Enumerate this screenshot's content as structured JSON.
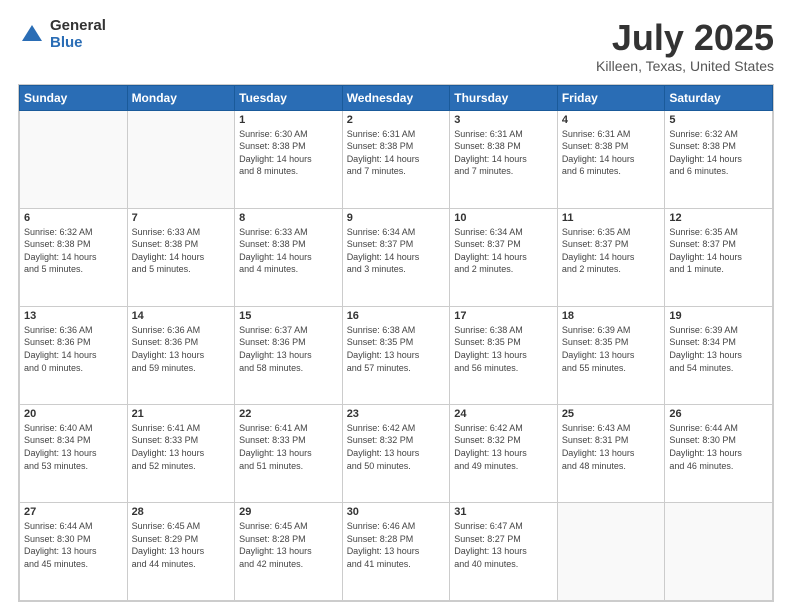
{
  "header": {
    "logo_general": "General",
    "logo_blue": "Blue",
    "month_title": "July 2025",
    "location": "Killeen, Texas, United States"
  },
  "weekdays": [
    "Sunday",
    "Monday",
    "Tuesday",
    "Wednesday",
    "Thursday",
    "Friday",
    "Saturday"
  ],
  "weeks": [
    [
      {
        "day": "",
        "info": ""
      },
      {
        "day": "",
        "info": ""
      },
      {
        "day": "1",
        "info": "Sunrise: 6:30 AM\nSunset: 8:38 PM\nDaylight: 14 hours\nand 8 minutes."
      },
      {
        "day": "2",
        "info": "Sunrise: 6:31 AM\nSunset: 8:38 PM\nDaylight: 14 hours\nand 7 minutes."
      },
      {
        "day": "3",
        "info": "Sunrise: 6:31 AM\nSunset: 8:38 PM\nDaylight: 14 hours\nand 7 minutes."
      },
      {
        "day": "4",
        "info": "Sunrise: 6:31 AM\nSunset: 8:38 PM\nDaylight: 14 hours\nand 6 minutes."
      },
      {
        "day": "5",
        "info": "Sunrise: 6:32 AM\nSunset: 8:38 PM\nDaylight: 14 hours\nand 6 minutes."
      }
    ],
    [
      {
        "day": "6",
        "info": "Sunrise: 6:32 AM\nSunset: 8:38 PM\nDaylight: 14 hours\nand 5 minutes."
      },
      {
        "day": "7",
        "info": "Sunrise: 6:33 AM\nSunset: 8:38 PM\nDaylight: 14 hours\nand 5 minutes."
      },
      {
        "day": "8",
        "info": "Sunrise: 6:33 AM\nSunset: 8:38 PM\nDaylight: 14 hours\nand 4 minutes."
      },
      {
        "day": "9",
        "info": "Sunrise: 6:34 AM\nSunset: 8:37 PM\nDaylight: 14 hours\nand 3 minutes."
      },
      {
        "day": "10",
        "info": "Sunrise: 6:34 AM\nSunset: 8:37 PM\nDaylight: 14 hours\nand 2 minutes."
      },
      {
        "day": "11",
        "info": "Sunrise: 6:35 AM\nSunset: 8:37 PM\nDaylight: 14 hours\nand 2 minutes."
      },
      {
        "day": "12",
        "info": "Sunrise: 6:35 AM\nSunset: 8:37 PM\nDaylight: 14 hours\nand 1 minute."
      }
    ],
    [
      {
        "day": "13",
        "info": "Sunrise: 6:36 AM\nSunset: 8:36 PM\nDaylight: 14 hours\nand 0 minutes."
      },
      {
        "day": "14",
        "info": "Sunrise: 6:36 AM\nSunset: 8:36 PM\nDaylight: 13 hours\nand 59 minutes."
      },
      {
        "day": "15",
        "info": "Sunrise: 6:37 AM\nSunset: 8:36 PM\nDaylight: 13 hours\nand 58 minutes."
      },
      {
        "day": "16",
        "info": "Sunrise: 6:38 AM\nSunset: 8:35 PM\nDaylight: 13 hours\nand 57 minutes."
      },
      {
        "day": "17",
        "info": "Sunrise: 6:38 AM\nSunset: 8:35 PM\nDaylight: 13 hours\nand 56 minutes."
      },
      {
        "day": "18",
        "info": "Sunrise: 6:39 AM\nSunset: 8:35 PM\nDaylight: 13 hours\nand 55 minutes."
      },
      {
        "day": "19",
        "info": "Sunrise: 6:39 AM\nSunset: 8:34 PM\nDaylight: 13 hours\nand 54 minutes."
      }
    ],
    [
      {
        "day": "20",
        "info": "Sunrise: 6:40 AM\nSunset: 8:34 PM\nDaylight: 13 hours\nand 53 minutes."
      },
      {
        "day": "21",
        "info": "Sunrise: 6:41 AM\nSunset: 8:33 PM\nDaylight: 13 hours\nand 52 minutes."
      },
      {
        "day": "22",
        "info": "Sunrise: 6:41 AM\nSunset: 8:33 PM\nDaylight: 13 hours\nand 51 minutes."
      },
      {
        "day": "23",
        "info": "Sunrise: 6:42 AM\nSunset: 8:32 PM\nDaylight: 13 hours\nand 50 minutes."
      },
      {
        "day": "24",
        "info": "Sunrise: 6:42 AM\nSunset: 8:32 PM\nDaylight: 13 hours\nand 49 minutes."
      },
      {
        "day": "25",
        "info": "Sunrise: 6:43 AM\nSunset: 8:31 PM\nDaylight: 13 hours\nand 48 minutes."
      },
      {
        "day": "26",
        "info": "Sunrise: 6:44 AM\nSunset: 8:30 PM\nDaylight: 13 hours\nand 46 minutes."
      }
    ],
    [
      {
        "day": "27",
        "info": "Sunrise: 6:44 AM\nSunset: 8:30 PM\nDaylight: 13 hours\nand 45 minutes."
      },
      {
        "day": "28",
        "info": "Sunrise: 6:45 AM\nSunset: 8:29 PM\nDaylight: 13 hours\nand 44 minutes."
      },
      {
        "day": "29",
        "info": "Sunrise: 6:45 AM\nSunset: 8:28 PM\nDaylight: 13 hours\nand 42 minutes."
      },
      {
        "day": "30",
        "info": "Sunrise: 6:46 AM\nSunset: 8:28 PM\nDaylight: 13 hours\nand 41 minutes."
      },
      {
        "day": "31",
        "info": "Sunrise: 6:47 AM\nSunset: 8:27 PM\nDaylight: 13 hours\nand 40 minutes."
      },
      {
        "day": "",
        "info": ""
      },
      {
        "day": "",
        "info": ""
      }
    ]
  ]
}
